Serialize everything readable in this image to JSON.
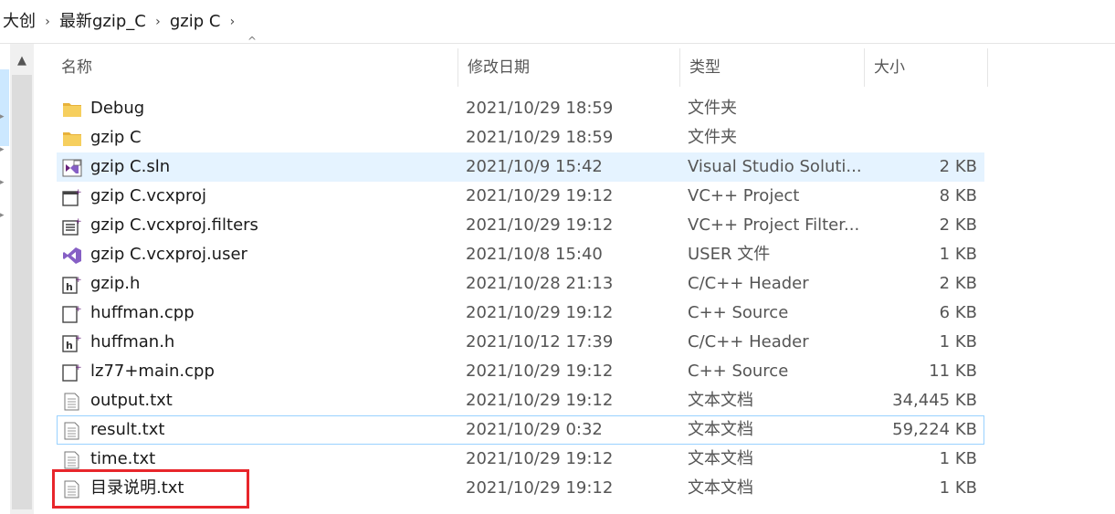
{
  "breadcrumb": {
    "items": [
      "大创",
      "最新gzip_C",
      "gzip C"
    ],
    "separator": "›"
  },
  "columns": {
    "name": "名称",
    "date": "修改日期",
    "type": "类型",
    "size": "大小"
  },
  "files": [
    {
      "name": "Debug",
      "date": "2021/10/29 18:59",
      "type": "文件夹",
      "size": "",
      "icon": "folder-icon"
    },
    {
      "name": "gzip C",
      "date": "2021/10/29 18:59",
      "type": "文件夹",
      "size": "",
      "icon": "folder-icon"
    },
    {
      "name": "gzip C.sln",
      "date": "2021/10/9 15:42",
      "type": "Visual Studio Soluti...",
      "size": "2 KB",
      "icon": "visual-studio-solution-icon"
    },
    {
      "name": "gzip C.vcxproj",
      "date": "2021/10/29 19:12",
      "type": "VC++ Project",
      "size": "8 KB",
      "icon": "vc-project-icon"
    },
    {
      "name": "gzip C.vcxproj.filters",
      "date": "2021/10/29 19:12",
      "type": "VC++ Project Filter...",
      "size": "2 KB",
      "icon": "vc-project-filters-icon"
    },
    {
      "name": "gzip C.vcxproj.user",
      "date": "2021/10/8 15:40",
      "type": "USER 文件",
      "size": "1 KB",
      "icon": "visual-studio-icon"
    },
    {
      "name": "gzip.h",
      "date": "2021/10/28 21:13",
      "type": "C/C++ Header",
      "size": "2 KB",
      "icon": "header-file-icon"
    },
    {
      "name": "huffman.cpp",
      "date": "2021/10/29 19:12",
      "type": "C++ Source",
      "size": "6 KB",
      "icon": "cpp-source-icon"
    },
    {
      "name": "huffman.h",
      "date": "2021/10/12 17:39",
      "type": "C/C++ Header",
      "size": "1 KB",
      "icon": "header-file-icon"
    },
    {
      "name": "lz77+main.cpp",
      "date": "2021/10/29 19:12",
      "type": "C++ Source",
      "size": "11 KB",
      "icon": "cpp-source-icon"
    },
    {
      "name": "output.txt",
      "date": "2021/10/29 19:12",
      "type": "文本文档",
      "size": "34,445 KB",
      "icon": "text-file-icon"
    },
    {
      "name": "result.txt",
      "date": "2021/10/29 0:32",
      "type": "文本文档",
      "size": "59,224 KB",
      "icon": "text-file-icon"
    },
    {
      "name": "time.txt",
      "date": "2021/10/29 19:12",
      "type": "文本文档",
      "size": "1 KB",
      "icon": "text-file-icon"
    },
    {
      "name": "目录说明.txt",
      "date": "2021/10/29 19:12",
      "type": "文本文档",
      "size": "1 KB",
      "icon": "text-file-icon"
    }
  ],
  "selected_index": 2,
  "focused_index": 11,
  "highlighted_index": 13,
  "colors": {
    "selection": "#e5f3ff",
    "focus_border": "#99d1ff",
    "highlight_box": "#e8262b",
    "folder": "#f2c14e",
    "vs_purple": "#68217a"
  }
}
